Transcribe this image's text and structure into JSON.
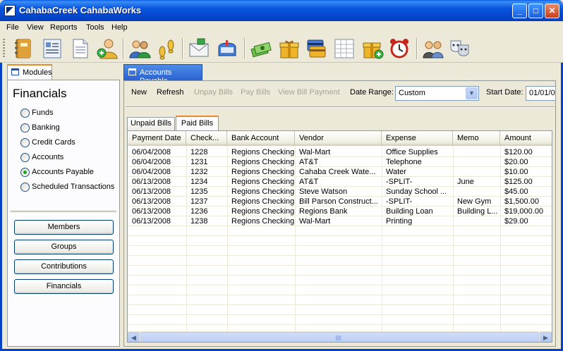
{
  "window": {
    "title": "CahabaCreek CahabaWorks",
    "controls": [
      "minimize",
      "maximize",
      "close"
    ]
  },
  "menu": [
    "File",
    "View",
    "Reports",
    "Tools",
    "Help"
  ],
  "toolbar": {
    "icons": [
      "address-book-icon",
      "member-list-icon",
      "document-icon",
      "person-green-icon",
      "people-icon",
      "footsteps-icon",
      "envelope-icon",
      "mailbox-icon",
      "money-icon",
      "gift-box-icon",
      "credit-card-icon",
      "spreadsheet-grid-icon",
      "gift-box-green-icon",
      "alarm-clock-icon",
      "users-icon",
      "theater-masks-icon"
    ]
  },
  "modules_tab": {
    "label": "Modules"
  },
  "left_panel": {
    "title": "Financials",
    "options": [
      {
        "label": "Funds",
        "selected": false
      },
      {
        "label": "Banking",
        "selected": false
      },
      {
        "label": "Credit Cards",
        "selected": false
      },
      {
        "label": "Accounts",
        "selected": false
      },
      {
        "label": "Accounts Payable",
        "selected": true
      },
      {
        "label": "Scheduled Transactions",
        "selected": false
      }
    ],
    "buttons": [
      "Members",
      "Groups",
      "Contributions",
      "Financials"
    ]
  },
  "main_tab": {
    "label": "Accounts Payable"
  },
  "actions": {
    "new": "New",
    "refresh": "Refresh",
    "unpay_bills": "Unpay Bills",
    "pay_bills": "Pay Bills",
    "view_bill_payment": "View Bill Payment"
  },
  "date_range": {
    "label": "Date Range:",
    "value": "Custom"
  },
  "start_date": {
    "label": "Start Date:",
    "value": "01/01/0"
  },
  "sub_tabs": [
    {
      "label": "Unpaid Bills",
      "active": false
    },
    {
      "label": "Paid Bills",
      "active": true
    }
  ],
  "table": {
    "columns": [
      "Payment Date",
      "Check...",
      "Bank Account",
      "Vendor",
      "Expense",
      "Memo",
      "Amount"
    ],
    "rows": [
      [
        "06/04/2008",
        "1228",
        "Regions Checking",
        "Wal-Mart",
        "Office Supplies",
        "",
        "$120.00"
      ],
      [
        "06/04/2008",
        "1231",
        "Regions Checking",
        "AT&T",
        "Telephone",
        "",
        "$20.00"
      ],
      [
        "06/04/2008",
        "1232",
        "Regions Checking",
        "Cahaba Creek Wate...",
        "Water",
        "",
        "$10.00"
      ],
      [
        "06/13/2008",
        "1234",
        "Regions Checking",
        "AT&T",
        "-SPLIT-",
        "June",
        "$125.00"
      ],
      [
        "06/13/2008",
        "1235",
        "Regions Checking",
        "Steve Watson",
        "Sunday School ...",
        "",
        "$45.00"
      ],
      [
        "06/13/2008",
        "1237",
        "Regions Checking",
        "Bill Parson Construct...",
        "-SPLIT-",
        "New Gym",
        "$1,500.00"
      ],
      [
        "06/13/2008",
        "1236",
        "Regions Checking",
        "Regions Bank",
        "Building Loan",
        "Building L...",
        "$19,000.00"
      ],
      [
        "06/13/2008",
        "1238",
        "Regions Checking",
        "Wal-Mart",
        "Printing",
        "",
        "$29.00"
      ]
    ]
  }
}
